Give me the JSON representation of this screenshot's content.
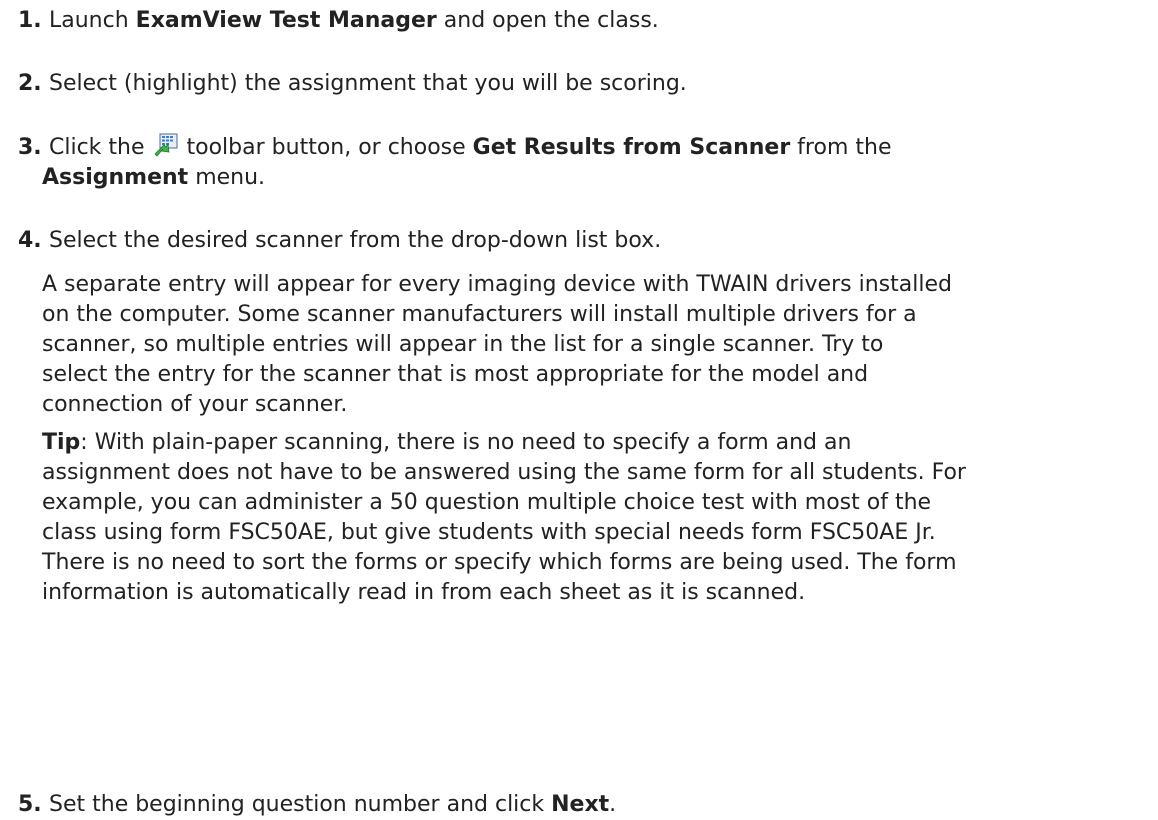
{
  "steps": [
    {
      "number": "1.",
      "pre": "Launch ",
      "bold": "ExamView Test Manager",
      "post": " and open the class."
    },
    {
      "number": "2.",
      "text": "Select (highlight) the assignment that you will be scoring."
    },
    {
      "number": "3.",
      "pre": "Click the ",
      "icon": "scanner-results-icon",
      "mid": " toolbar button, or choose ",
      "bold1": "Get Results from Scanner",
      "mid2": " from the",
      "bold2": "Assignment",
      "post": " menu."
    },
    {
      "number": "4.",
      "text": "Select the desired scanner from the drop-down list box.",
      "para1": [
        "A separate entry will appear for every imaging device with TWAIN drivers installed",
        "on the computer. Some scanner manufacturers will install multiple drivers for a",
        "scanner, so multiple entries will appear in the list for a single scanner. Try to",
        "select the entry for the scanner that is most appropriate for the model and",
        "connection of your scanner."
      ],
      "tip_label": "Tip",
      "tip_lines": [
        ": With plain-paper scanning, there is no need to specify a form and an",
        "assignment does not have to be answered using the same form for all students. For",
        "example, you can administer a 50 question multiple choice test with most of the",
        "class using form FSC50AE, but give students with special needs form FSC50AE Jr.",
        "There is no need to sort the forms or specify which forms are being used. The form",
        "information is automatically read in from each sheet as it is scanned."
      ]
    },
    {
      "number": "5.",
      "pre": "Set the beginning question number and click ",
      "bold": "Next",
      "post": "."
    }
  ]
}
